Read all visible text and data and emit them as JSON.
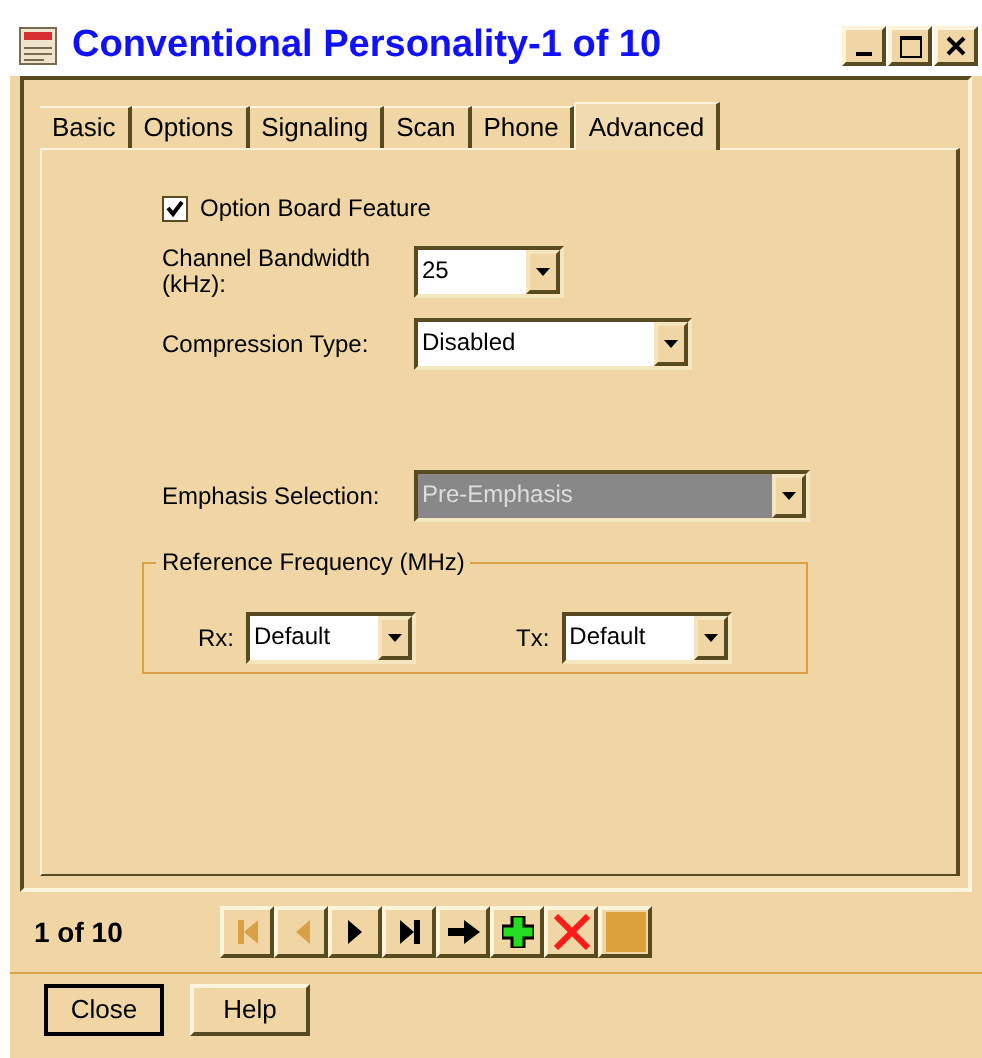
{
  "window": {
    "title": "Conventional Personality-1 of 10"
  },
  "tabs": [
    {
      "label": "Basic",
      "selected": false
    },
    {
      "label": "Options",
      "selected": false
    },
    {
      "label": "Signaling",
      "selected": false
    },
    {
      "label": "Scan",
      "selected": false
    },
    {
      "label": "Phone",
      "selected": false
    },
    {
      "label": "Advanced",
      "selected": true
    }
  ],
  "option_board": {
    "label": "Option Board Feature",
    "checked": true
  },
  "fields": [
    {
      "label": "Channel Bandwidth (kHz):",
      "value": "25",
      "disabled": false
    },
    {
      "label": "Compression Type:",
      "value": "Disabled",
      "disabled": false
    },
    {
      "label": "Emphasis Selection:",
      "value": "Pre-Emphasis",
      "disabled": true
    }
  ],
  "reference_frequency": {
    "title": "Reference Frequency (MHz)",
    "fields": [
      {
        "label": "Rx:",
        "value": "Default"
      },
      {
        "label": "Tx:",
        "value": "Default"
      }
    ]
  },
  "record_counter": "1 of 10",
  "nav_buttons": [
    {
      "kind": "first",
      "disabled": true
    },
    {
      "kind": "prev",
      "disabled": true
    },
    {
      "kind": "next",
      "disabled": false
    },
    {
      "kind": "last",
      "disabled": false
    },
    {
      "kind": "goto",
      "disabled": false
    },
    {
      "kind": "add",
      "disabled": false
    },
    {
      "kind": "delete",
      "disabled": false
    },
    {
      "kind": "save",
      "disabled": false
    }
  ],
  "buttons": [
    "Close",
    "Help"
  ]
}
